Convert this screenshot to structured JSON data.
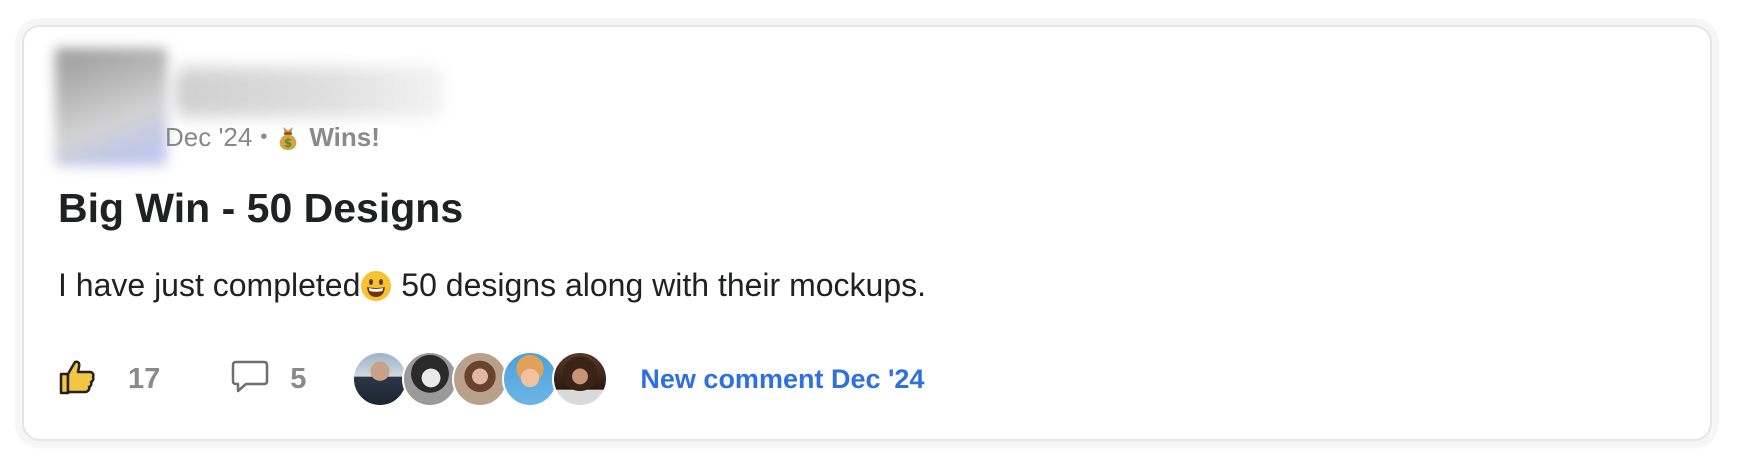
{
  "post": {
    "date": "Dec '24",
    "separator": "•",
    "category_icon": "money-bag-icon",
    "category": "Wins!",
    "title": "Big Win - 50 Designs",
    "body_before_emoji": "I have just completed",
    "body_emoji": "grinning-face-icon",
    "body_after_emoji": " 50 designs along with their mockups."
  },
  "footer": {
    "like_icon": "thumbs-up-icon",
    "like_count": "17",
    "comment_icon": "comment-bubble-icon",
    "comment_count": "5",
    "participants": [
      "avatar-1",
      "avatar-2",
      "avatar-3",
      "avatar-4",
      "avatar-5"
    ],
    "new_comment_label": "New comment Dec '24"
  },
  "colors": {
    "link": "#2f6fe4",
    "muted": "#888888",
    "text": "#202124"
  }
}
